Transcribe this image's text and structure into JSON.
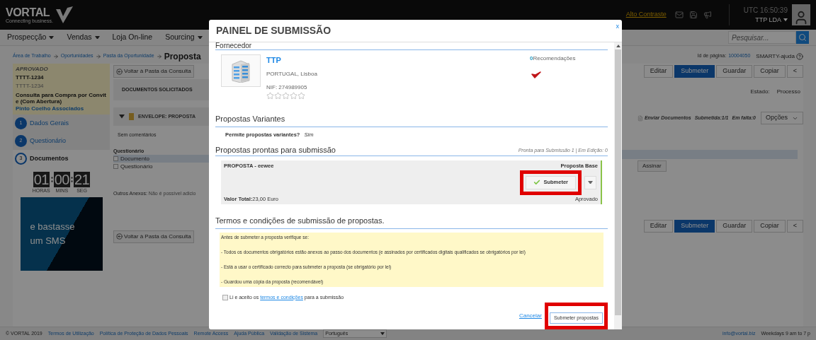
{
  "header": {
    "logo": "VORTAL",
    "logo_tagline": "Connecting business.",
    "high_contrast_link": "Alto Contraste",
    "clock": "UTC 16:50:39",
    "account": "TTP LDA"
  },
  "nav": {
    "items": [
      {
        "label": "Prospecção",
        "has_menu": true
      },
      {
        "label": "Vendas",
        "has_menu": true
      },
      {
        "label": "Loja On-line",
        "has_menu": false
      },
      {
        "label": "Sourcing",
        "has_menu": true
      }
    ],
    "search": {
      "placeholder": "Pesquisar..."
    }
  },
  "breadcrumbs": [
    {
      "label": "Área de Trabalho",
      "kind": "link"
    },
    {
      "label": "Oportunidades",
      "kind": "link"
    },
    {
      "label": "Pasta da Oportunidade",
      "kind": "link"
    },
    {
      "label": "Proposta",
      "kind": "current"
    }
  ],
  "page_id": {
    "label": "Id de página:",
    "value": "10004050",
    "help": "SMARTY-ajuda"
  },
  "summary": {
    "status": "APROVADO",
    "code": "TTTT-1234",
    "code_secondary": "TTTT-1234",
    "title": "Consulta para Compra por Convite (Com Abertura)",
    "entity": "Pinto Coelho Associados"
  },
  "steps": [
    {
      "number": "1",
      "label": "Dados Gerais",
      "selected": false
    },
    {
      "number": "2",
      "label": "Questionário",
      "selected": false
    },
    {
      "number": "3",
      "label": "Documentos",
      "selected": true
    }
  ],
  "timer": {
    "hours": "01",
    "minutes": "00",
    "seconds": "21",
    "hours_label": "HORAS",
    "minutes_label": "MINS",
    "seconds_label": "SEG"
  },
  "ad": {
    "text": "e bastasse um SMS"
  },
  "documents_panel": {
    "back_button": "Voltar à Pasta da Consulta",
    "section_title": "DOCUMENTOS SOLICITADOS",
    "envelope": "ENVELOPE: PROPOSTA",
    "comments": "Sem comentários",
    "group": "Questionário",
    "documents": [
      {
        "label": "Documento",
        "checked": false,
        "selected": true
      },
      {
        "label": "Questionário",
        "checked": false,
        "selected": false
      }
    ],
    "attachments_label": "Outros Anexos:",
    "attachments_note": "Não é possível adicio",
    "back_button_bottom": "Voltar à Pasta da Consulta"
  },
  "actions": {
    "toolbar": [
      {
        "label": "Editar",
        "selected": false
      },
      {
        "label": "Submeter",
        "selected": true
      },
      {
        "label": "Guardar",
        "selected": false
      },
      {
        "label": "Copiar",
        "selected": false
      },
      {
        "label": "<",
        "selected": false
      }
    ],
    "state_label": "Estado:",
    "state_value": "Processo",
    "send_documents": "Enviar Documentos",
    "submitted": "Submetida:1/1",
    "missing": "Em falta:0",
    "options": "Opções",
    "sign_button": "Assinar",
    "toolbar_bottom": [
      {
        "label": "Editar",
        "selected": false
      },
      {
        "label": "Submeter",
        "selected": true
      },
      {
        "label": "Guardar",
        "selected": false
      },
      {
        "label": "Copiar",
        "selected": false
      },
      {
        "label": "<",
        "selected": false
      }
    ]
  },
  "footer": {
    "copyright": "© VORTAL 2019",
    "links": [
      "Termos de Utilização",
      "Política de Proteção de Dados Pessoais",
      "Remote Access",
      "Ajuda Pública",
      "Validação de Sistema"
    ],
    "language": "Português",
    "email": "info@vortal.biz",
    "hours": "Weekdays 9 am to 7 p"
  },
  "modal": {
    "title": "PAINEL DE SUBMISSÃO",
    "close": "x",
    "supplier_section": "Fornecedor",
    "supplier": {
      "name": "TTP",
      "location": "PORTUGAL, Lisboa",
      "nif": "NIF: 274989905",
      "stars": 0,
      "recommendations_count": "0",
      "recommendations_label": "Recomendações"
    },
    "variants_section": "Propostas Variantes",
    "variants_question": "Permite propostas variantes?",
    "variants_answer": "Sim",
    "ready_section": "Propostas prontas para submissão",
    "ready_summary": "Pronta para Submissão 1 | Em Edição: 0",
    "proposal": {
      "name": "PROPOSTA - eewee",
      "type": "Proposta Base",
      "submit_button": "Submeter",
      "total_label": "Valor Total:",
      "total_value": "23,00 Euro",
      "status": "Aprovado",
      "highlighted": true
    },
    "terms_section": "Termos e condições de submissão de propostas.",
    "terms": [
      "Antes de submeter a proposta verifique se:",
      "- Todos os documentos obrigatórios estão anexos ao passo dos documentos (e assinados por certificados digitais qualificados se obrigatórios por lei)",
      "- Está a usar o certificado correcto para submeter a proposta (se obrigatório por lei)",
      "- Guardou uma cópia da proposta (recomendável)"
    ],
    "accept": {
      "checked": false,
      "before": "Li e aceito os",
      "link": "termos e condições",
      "after": "para a submissão"
    },
    "cancel": "Cancelar",
    "submit_button": "Submeter propostas",
    "submit_highlighted": true
  }
}
